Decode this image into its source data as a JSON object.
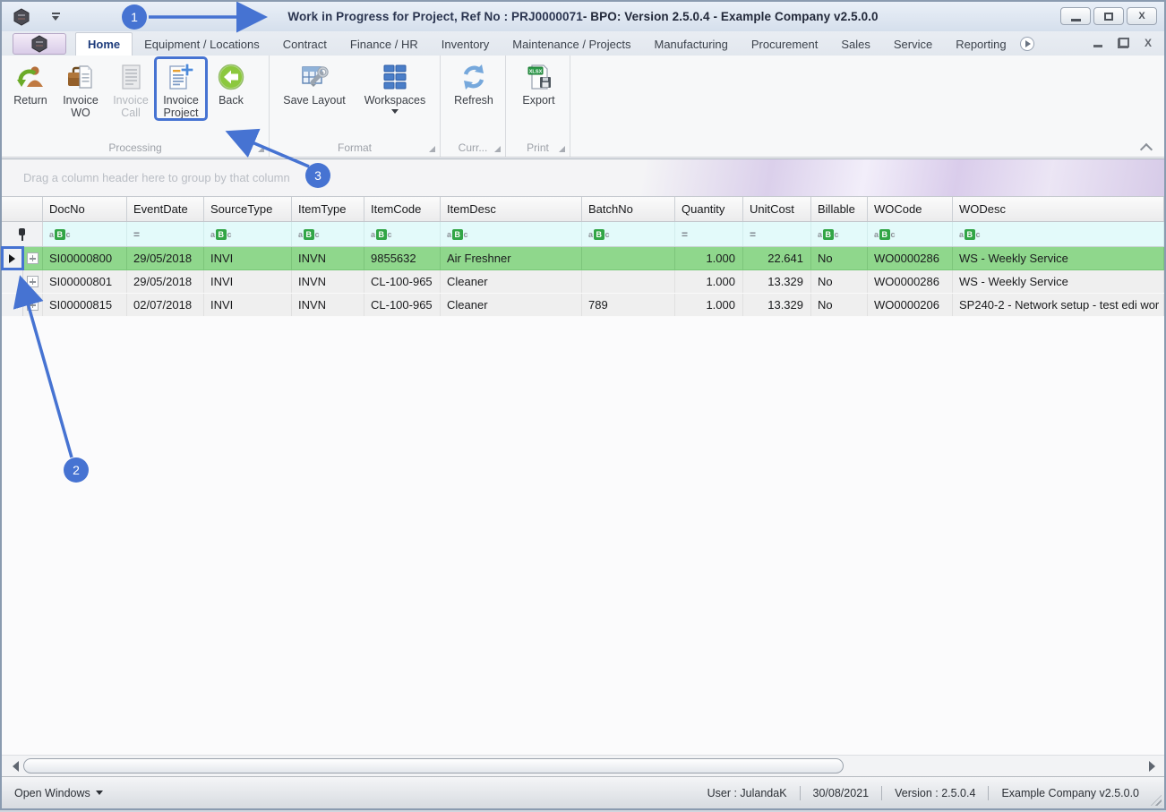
{
  "titlebar": {
    "title_main": "Work in Progress for Project, Ref No : PRJ0000071",
    "title_rest": " - BPO: Version 2.5.0.4 - Example Company v2.5.0.0"
  },
  "tabs": [
    "Home",
    "Equipment / Locations",
    "Contract",
    "Finance / HR",
    "Inventory",
    "Maintenance / Projects",
    "Manufacturing",
    "Procurement",
    "Sales",
    "Service",
    "Reporting"
  ],
  "ribbon": {
    "groups": [
      {
        "label": "Processing"
      },
      {
        "label": "Format"
      },
      {
        "label": "Curr..."
      },
      {
        "label": "Print"
      }
    ],
    "buttons": {
      "return": "Return",
      "invoice_wo": [
        "Invoice",
        "WO"
      ],
      "invoice_call": [
        "Invoice",
        "Call"
      ],
      "invoice_project": [
        "Invoice",
        "Project"
      ],
      "back": "Back",
      "save_layout": "Save Layout",
      "workspaces": "Workspaces",
      "refresh": "Refresh",
      "export": "Export"
    },
    "export_badge": "XLSX"
  },
  "grid": {
    "group_hint": "Drag a column header here to group by that column",
    "columns": [
      "DocNo",
      "EventDate",
      "SourceType",
      "ItemType",
      "ItemCode",
      "ItemDesc",
      "BatchNo",
      "Quantity",
      "UnitCost",
      "Billable",
      "WOCode",
      "WODesc"
    ],
    "filter_icon": {
      "a": "a",
      "b": "B",
      "c": "c",
      "eq": "="
    },
    "rows": [
      {
        "cells": [
          "SI00000800",
          "29/05/2018",
          "INVI",
          "INVN",
          "9855632",
          "Air Freshner",
          "",
          "1.000",
          "22.641",
          "No",
          "WO0000286",
          "WS - Weekly Service"
        ]
      },
      {
        "cells": [
          "SI00000801",
          "29/05/2018",
          "INVI",
          "INVN",
          "CL-100-965",
          "Cleaner",
          "",
          "1.000",
          "13.329",
          "No",
          "WO0000286",
          "WS - Weekly Service"
        ]
      },
      {
        "cells": [
          "SI00000815",
          "02/07/2018",
          "INVI",
          "INVN",
          "CL-100-965",
          "Cleaner",
          "789",
          "1.000",
          "13.329",
          "No",
          "WO0000206",
          "SP240-2 - Network setup - test edi wor"
        ]
      }
    ]
  },
  "statusbar": {
    "open_windows": "Open Windows",
    "user": "User : JulandaK",
    "date": "30/08/2021",
    "version": "Version : 2.5.0.4",
    "company": "Example Company v2.5.0.0"
  },
  "annotations": {
    "steps": [
      "1",
      "2",
      "3"
    ],
    "color": "#4673d2"
  }
}
